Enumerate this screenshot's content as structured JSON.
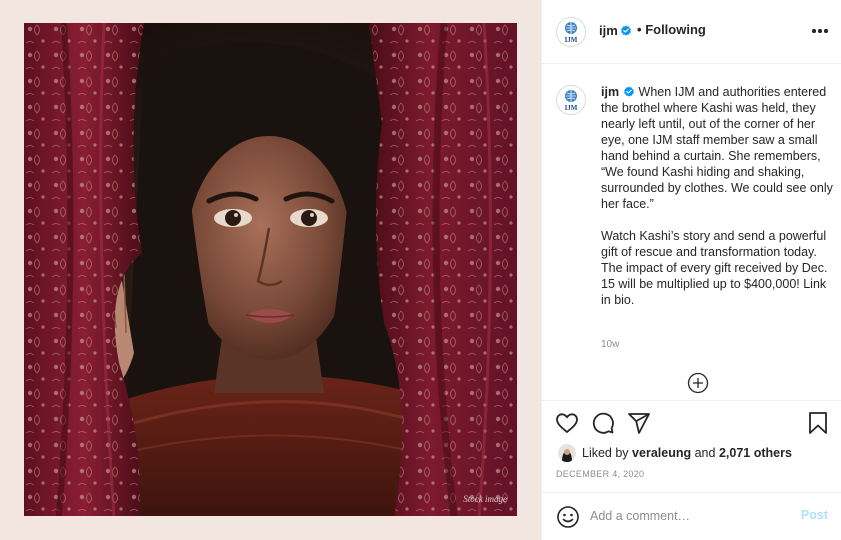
{
  "colors": {
    "accent": "#0095f6",
    "post_disabled": "#b2dffc",
    "text": "#262626",
    "muted": "#8e8e8e",
    "media_background": "#f3e6e1"
  },
  "media": {
    "stock_label": "Stock image",
    "alt": "Young woman peering out from behind patterned red curtains"
  },
  "header": {
    "avatar_text": "IJM",
    "username": "ijm",
    "separator": "•",
    "follow_status": "Following",
    "more_icon": "more-options-icon"
  },
  "caption": {
    "avatar_text": "IJM",
    "username": "ijm",
    "paragraph1": "When IJM and authorities entered the brothel where Kashi was held, they nearly left until, out of the corner of her eye, one IJM staff member saw a small hand behind a curtain. She remembers, “We found Kashi hiding and shaking, surrounded by clothes. We could see only her face.”",
    "paragraph2": "Watch Kashi’s story and send a powerful gift of rescue and transformation today. The impact of every gift received by Dec. 15 will be multiplied up to $400,000! Link in bio.",
    "time_ago": "10w",
    "load_more_icon": "plus-circle-icon"
  },
  "actions": {
    "icons": [
      "heart-icon",
      "comment-icon",
      "share-icon",
      "bookmark-icon"
    ],
    "liked_by_prefix": "Liked by",
    "liked_by_user": "veraleung",
    "and_text": "and",
    "others_count": "2,071 others",
    "date": "DECEMBER 4, 2020"
  },
  "comment": {
    "placeholder": "Add a comment…",
    "post_label": "Post",
    "emoji_icon": "emoji-icon"
  }
}
